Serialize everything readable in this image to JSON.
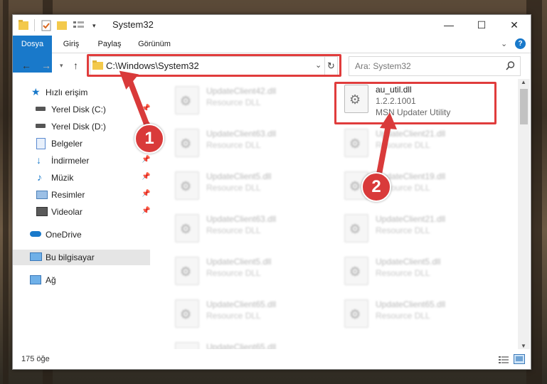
{
  "window": {
    "title": "System32",
    "controls": {
      "minimize": "—",
      "maximize": "☐",
      "close": "✕"
    }
  },
  "ribbon": {
    "tabs": [
      "Dosya",
      "Giriş",
      "Paylaş",
      "Görünüm"
    ]
  },
  "address": {
    "path": "C:\\Windows\\System32",
    "search_placeholder": "Ara: System32"
  },
  "sidebar": {
    "items": [
      {
        "label": "Hızlı erişim",
        "icon": "star-icon",
        "pinned": false
      },
      {
        "label": "Yerel Disk (C:)",
        "icon": "drive-icon",
        "pinned": true
      },
      {
        "label": "Yerel Disk (D:)",
        "icon": "drive-icon",
        "pinned": true
      },
      {
        "label": "Belgeler",
        "icon": "documents-icon",
        "pinned": true
      },
      {
        "label": "İndirmeler",
        "icon": "downloads-icon",
        "pinned": true
      },
      {
        "label": "Müzik",
        "icon": "music-icon",
        "pinned": true
      },
      {
        "label": "Resimler",
        "icon": "pictures-icon",
        "pinned": true
      },
      {
        "label": "Videolar",
        "icon": "videos-icon",
        "pinned": true
      },
      {
        "label": "OneDrive",
        "icon": "cloud-icon",
        "pinned": false
      },
      {
        "label": "Bu bilgisayar",
        "icon": "computer-icon",
        "pinned": false
      },
      {
        "label": "Ağ",
        "icon": "network-icon",
        "pinned": false
      }
    ]
  },
  "files": {
    "left_column": [
      {
        "name": "UpdateClient42.dll",
        "type": "Resource DLL"
      },
      {
        "name": "UpdateClient63.dll",
        "type": "Resource DLL"
      },
      {
        "name": "UpdateClient5.dll",
        "type": "Resource DLL"
      },
      {
        "name": "UpdateClient63.dll",
        "type": "Resource DLL"
      },
      {
        "name": "UpdateClient5.dll",
        "type": "Resource DLL"
      },
      {
        "name": "UpdateClient65.dll",
        "type": "Resource DLL"
      },
      {
        "name": "UpdateClient65.dll",
        "type": "Resource DLL"
      }
    ],
    "highlighted": {
      "name": "au_util.dll",
      "version": "1.2.2.1001",
      "description": "MSN Updater Utility"
    },
    "right_column": [
      {
        "name": "UpdateClient21.dll",
        "type": "Resource DLL"
      },
      {
        "name": "UpdateClient19.dll",
        "type": "Resource DLL"
      },
      {
        "name": "UpdateClient21.dll",
        "type": "Resource DLL"
      },
      {
        "name": "UpdateClient5.dll",
        "type": "Resource DLL"
      },
      {
        "name": "UpdateClient65.dll",
        "type": "Resource DLL"
      }
    ]
  },
  "status": {
    "item_count": "175 öğe"
  },
  "annotations": {
    "step1": "1",
    "step2": "2",
    "color": "#d93a3a"
  }
}
